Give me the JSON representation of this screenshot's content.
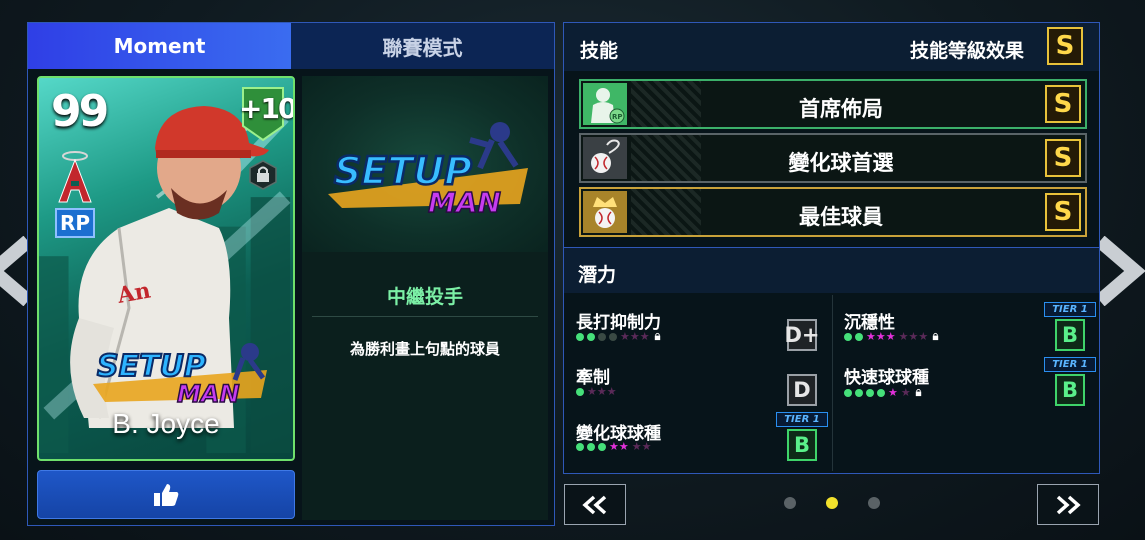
{
  "tabs": [
    {
      "label": "Moment",
      "active": true
    },
    {
      "label": "聯賽模式",
      "active": false
    }
  ],
  "card": {
    "rating": "99",
    "plus_level": "+10",
    "position": "RP",
    "player_name": "B. Joyce",
    "logo_text_top": "SETUP",
    "logo_text_bottom": "MAN"
  },
  "skill_detail": {
    "banner_top": "SETUP",
    "banner_bottom": "MAN",
    "type": "中繼投手",
    "description": "為勝利畫上句點的球員"
  },
  "skills": {
    "title": "技能",
    "level_effect_label": "技能等級效果",
    "level_effect_grade": "S",
    "items": [
      {
        "name": "首席佈局",
        "grade": "S",
        "icon": "rp-player-icon"
      },
      {
        "name": "變化球首選",
        "grade": "S",
        "icon": "curveball-icon"
      },
      {
        "name": "最佳球員",
        "grade": "S",
        "icon": "crown-ball-icon"
      }
    ]
  },
  "potential": {
    "title": "潛力",
    "items": [
      {
        "name": "長打抑制力",
        "grade": "D+",
        "tier": ""
      },
      {
        "name": "牽制",
        "grade": "D",
        "tier": ""
      },
      {
        "name": "變化球球種",
        "grade": "B",
        "tier": "TIER 1"
      },
      {
        "name": "沉穩性",
        "grade": "B",
        "tier": "TIER 1"
      },
      {
        "name": "快速球球種",
        "grade": "B",
        "tier": "TIER 1"
      }
    ]
  },
  "pagination": {
    "pages": 3,
    "current": 2
  },
  "colors": {
    "accent_blue": "#2f3fe6",
    "grade_gold": "#ffd84a",
    "grade_green": "#5af08a",
    "dot_active": "#f2e12c"
  }
}
